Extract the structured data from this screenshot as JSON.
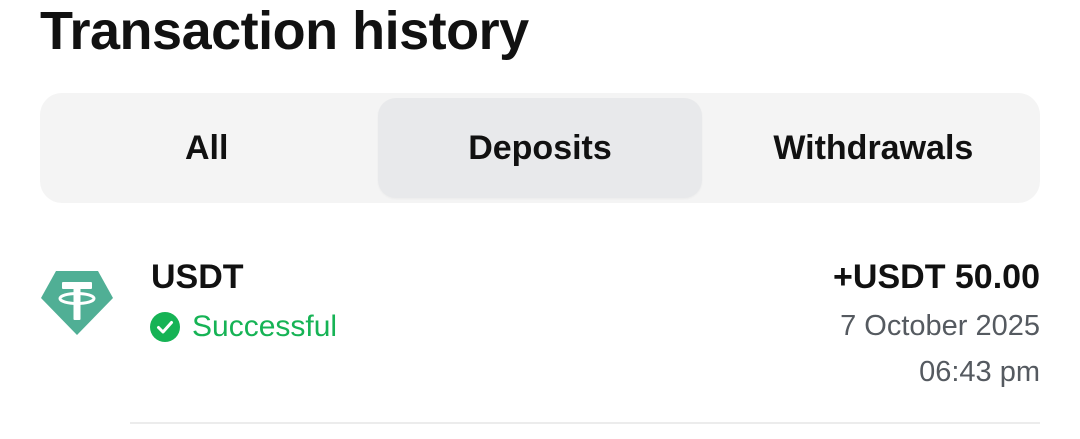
{
  "header": {
    "title": "Transaction history"
  },
  "tabs": [
    {
      "label": "All",
      "active": false
    },
    {
      "label": "Deposits",
      "active": true
    },
    {
      "label": "Withdrawals",
      "active": false
    }
  ],
  "transactions": [
    {
      "icon": "tether-usdt-icon",
      "asset": "USDT",
      "status": "Successful",
      "amount": "+USDT 50.00",
      "date": "7 October 2025",
      "time": "06:43 pm"
    }
  ],
  "colors": {
    "status_success": "#16b355",
    "tether_brand": "#50af95",
    "tab_bar_bg": "#f4f4f4",
    "tab_active_bg": "#e8e9eb",
    "secondary_text": "#555a60"
  }
}
